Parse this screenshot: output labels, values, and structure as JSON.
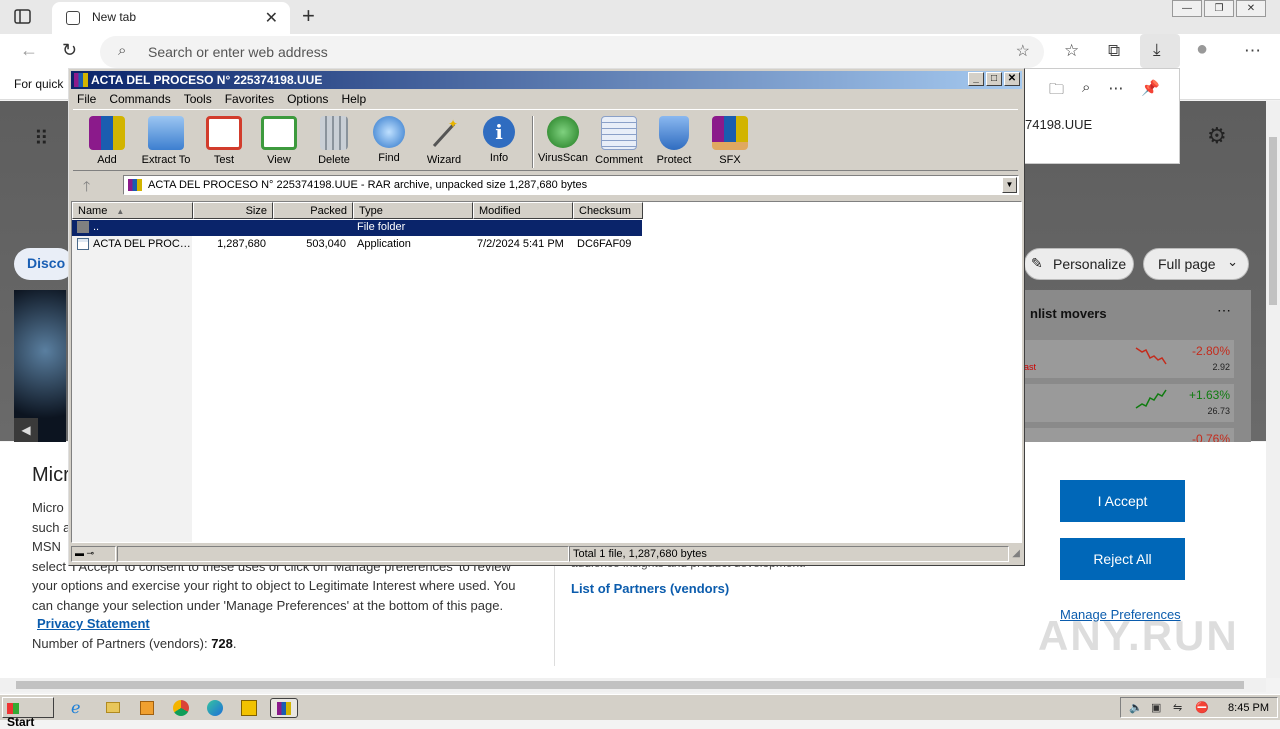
{
  "browser": {
    "tab_title": "New tab",
    "address_placeholder": "Search or enter web address",
    "favorites_hint": "For quick",
    "window_buttons": [
      "—",
      "❐",
      "✕"
    ]
  },
  "page": {
    "discover_label": "Disco",
    "personalize_label": "Personalize",
    "full_page_label": "Full page",
    "download_filename": "74198.UUE",
    "watchlist": {
      "title": "nlist movers",
      "stocks": [
        {
          "tag": "ast",
          "pct": "-2.80%",
          "value": "2.92",
          "color": "#c42b1c",
          "trend": "down"
        },
        {
          "tag": "",
          "pct": "+1.63%",
          "value": "26.73",
          "color": "#107c10",
          "trend": "up"
        },
        {
          "tag": "",
          "pct": "-0.76%",
          "value": "",
          "color": "#c42b1c",
          "trend": "down"
        }
      ]
    }
  },
  "consent": {
    "heading": "Micr",
    "paragraph_lines": [
      "Micro",
      "such a",
      "MSN",
      "select 'I Accept' to consent to these uses or click on 'Manage preferences' to review",
      "your options and exercise your right to object to Legitimate Interest where used.  You",
      "can change your selection under 'Manage Preferences' at the bottom of this page."
    ],
    "privacy_link": "Privacy Statement",
    "partners_label": "Number of Partners (vendors): ",
    "partners_count": "728",
    "faded_text": "audience insights and product development.",
    "list_partners": "List of Partners (vendors)",
    "accept": "I Accept",
    "reject": "Reject All",
    "manage": "Manage Preferences"
  },
  "watermark": "ANY.RUN",
  "winrar": {
    "title": "ACTA DEL PROCESO N° 225374198.UUE",
    "menu": [
      "File",
      "Commands",
      "Tools",
      "Favorites",
      "Options",
      "Help"
    ],
    "tools": [
      {
        "label": "Add",
        "icon": "add-icon",
        "color": "#b03a9e"
      },
      {
        "label": "Extract To",
        "icon": "extract-folder-icon",
        "color": "#4f8fd9"
      },
      {
        "label": "Test",
        "icon": "test-clipboard-icon",
        "color": "#d23c2c"
      },
      {
        "label": "View",
        "icon": "view-book-icon",
        "color": "#3d9a3d"
      },
      {
        "label": "Delete",
        "icon": "trash-icon",
        "color": "#9aa3ad"
      },
      {
        "label": "Find",
        "icon": "magnifier-icon",
        "color": "#2b74c9"
      },
      {
        "label": "Wizard",
        "icon": "wand-icon",
        "color": "#8a8a8a"
      },
      {
        "label": "Info",
        "icon": "info-icon",
        "color": "#2f6cc0"
      },
      {
        "label": "VirusScan",
        "icon": "bug-icon",
        "color": "#2f8a2f"
      },
      {
        "label": "Comment",
        "icon": "comment-icon",
        "color": "#8aa0c8"
      },
      {
        "label": "Protect",
        "icon": "shield-icon",
        "color": "#2f6cc0"
      },
      {
        "label": "SFX",
        "icon": "sfx-box-icon",
        "color": "#d89a3a"
      }
    ],
    "address": "ACTA DEL PROCESO N° 225374198.UUE - RAR archive, unpacked size 1,287,680 bytes",
    "columns": [
      "Name",
      "Size",
      "Packed",
      "Type",
      "Modified",
      "Checksum"
    ],
    "rows": [
      {
        "name": "..",
        "size": "",
        "packed": "",
        "type": "File folder",
        "modified": "",
        "checksum": ""
      },
      {
        "name": "ACTA DEL PROC…",
        "size": "1,287,680",
        "packed": "503,040",
        "type": "Application",
        "modified": "7/2/2024 5:41 PM",
        "checksum": "DC6FAF09"
      }
    ],
    "status": "Total 1 file, 1,287,680 bytes"
  },
  "taskbar": {
    "start": "Start",
    "clock": "8:45 PM"
  }
}
